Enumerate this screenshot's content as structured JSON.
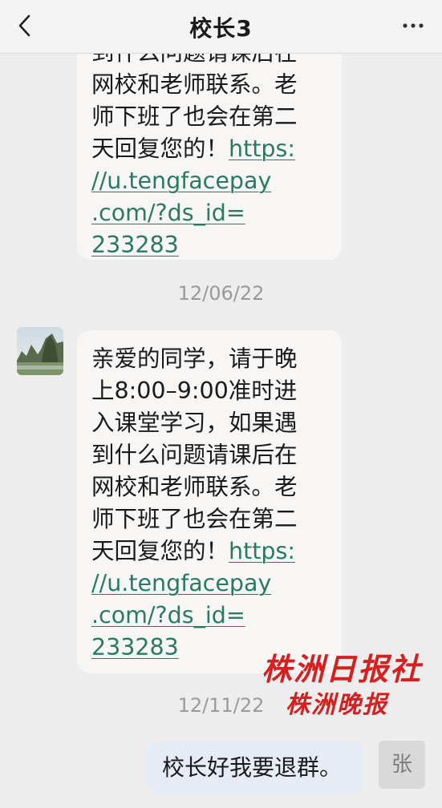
{
  "header": {
    "title": "校长3",
    "back_icon": "chevron-left-icon",
    "more_icon": "ellipsis-icon"
  },
  "messages": [
    {
      "lines": [
        "到什么问题请课后在",
        "网校和老师联系。老",
        "师下班了也会在第二"
      ],
      "link_line_prefix": "天回复您的！",
      "link_lines": [
        "https:",
        "//u.tengfacepay",
        ".com/?ds_id=",
        "233283"
      ]
    },
    {
      "lines": [
        "亲爱的同学，请于晚",
        "上8:00–9:00准时进",
        "入课堂学习，如果遇",
        "到什么问题请课后在",
        "网校和老师联系。老",
        "师下班了也会在第二"
      ],
      "link_line_prefix": "天回复您的！",
      "link_lines": [
        "https:",
        "//u.tengfacepay",
        ".com/?ds_id=",
        "233283"
      ]
    }
  ],
  "timestamps": [
    "12/06/22",
    "12/11/22"
  ],
  "sent": {
    "text": "校长好我要退群。",
    "avatar_text": "张"
  },
  "watermark": {
    "line1": "株洲日报社",
    "line2": "株洲晚报",
    "color": "#d32020"
  },
  "colors": {
    "background": "#ededed",
    "bubble": "#f7f6f5",
    "sent_bubble": "#e6ebf6",
    "link": "#2a7a63"
  }
}
